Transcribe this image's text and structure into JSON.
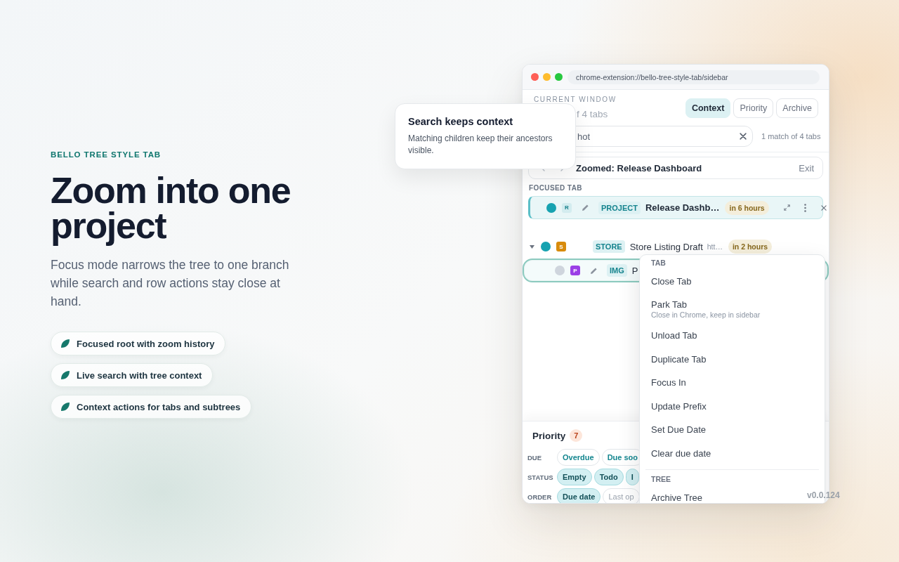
{
  "hero": {
    "eyebrow": "BELLO TREE STYLE TAB",
    "title": "Zoom into one project",
    "description": "Focus mode narrows the tree to one branch while search and row actions stay close at hand.",
    "features": [
      {
        "label": "Focused root with zoom history"
      },
      {
        "label": "Live search with tree context"
      },
      {
        "label": "Context actions for tabs and subtrees"
      }
    ]
  },
  "tooltip": {
    "title": "Search keeps context",
    "text": "Matching children keep their ancestors visible."
  },
  "browser": {
    "url": "chrome-extension://bello-tree-style-tab/sidebar"
  },
  "sidebar": {
    "header": {
      "label": "CURRENT WINDOW",
      "summary": "f 4 tabs"
    },
    "views": [
      {
        "label": "Context",
        "selected": true
      },
      {
        "label": "Priority",
        "selected": false
      },
      {
        "label": "Archive",
        "selected": false
      }
    ],
    "search": {
      "value": "hot",
      "result": "1 match of 4 tabs"
    },
    "zoom_bar": {
      "title": "Zoomed: Release Dashboard",
      "exit": "Exit"
    },
    "focused_label": "FOCUSED TAB",
    "focused_tab": {
      "status": {
        "color": "#17a2b0"
      },
      "badge": {
        "letter": "R",
        "color": "#d3ecef"
      },
      "tag": "PROJECT",
      "title": "Release Dashb…",
      "due": "in 6 hours"
    },
    "tree": [
      {
        "expanded": true,
        "selected": false,
        "status": {
          "color": "#17a2b0"
        },
        "badge": {
          "letter": "S",
          "color": "#d88b0c"
        },
        "tag": "STORE",
        "title": "Store Listing Draft",
        "url": "htt…",
        "due": "in 2 hours",
        "children": [
          {
            "selected": true,
            "status": {
              "color": "#cfd5dd"
            },
            "badge": {
              "letter": "P",
              "color": "#9b3fe6"
            },
            "tag": "IMG",
            "title": "P"
          }
        ]
      }
    ],
    "priority": {
      "title": "Priority",
      "count": "7",
      "filters": [
        {
          "label": "DUE",
          "kind": "toggle",
          "chips": [
            {
              "label": "Overdue",
              "selected": false
            },
            {
              "label": "Due soo",
              "selected": false
            }
          ]
        },
        {
          "label": "STATUS",
          "kind": "toggle",
          "chips": [
            {
              "label": "Empty",
              "selected": true
            },
            {
              "label": "Todo",
              "selected": true
            },
            {
              "label": "I",
              "selected": true
            }
          ]
        },
        {
          "label": "ORDER",
          "kind": "sort",
          "chips": [
            {
              "label": "Due date",
              "selected": true
            },
            {
              "label": "Last op",
              "selected": false
            }
          ]
        }
      ]
    },
    "context_menu": {
      "sections": [
        {
          "heading": "TAB",
          "items": [
            {
              "label": "Close Tab"
            },
            {
              "label": "Park Tab",
              "hint": "Close in Chrome, keep in sidebar"
            },
            {
              "label": "Unload Tab"
            },
            {
              "label": "Duplicate Tab"
            },
            {
              "label": "Focus In"
            },
            {
              "label": "Update Prefix"
            },
            {
              "label": "Set Due Date"
            },
            {
              "label": "Clear due date"
            }
          ]
        },
        {
          "heading": "TREE",
          "items": [
            {
              "label": "Archive Tree"
            }
          ]
        }
      ]
    }
  },
  "version": "v0.0.124"
}
